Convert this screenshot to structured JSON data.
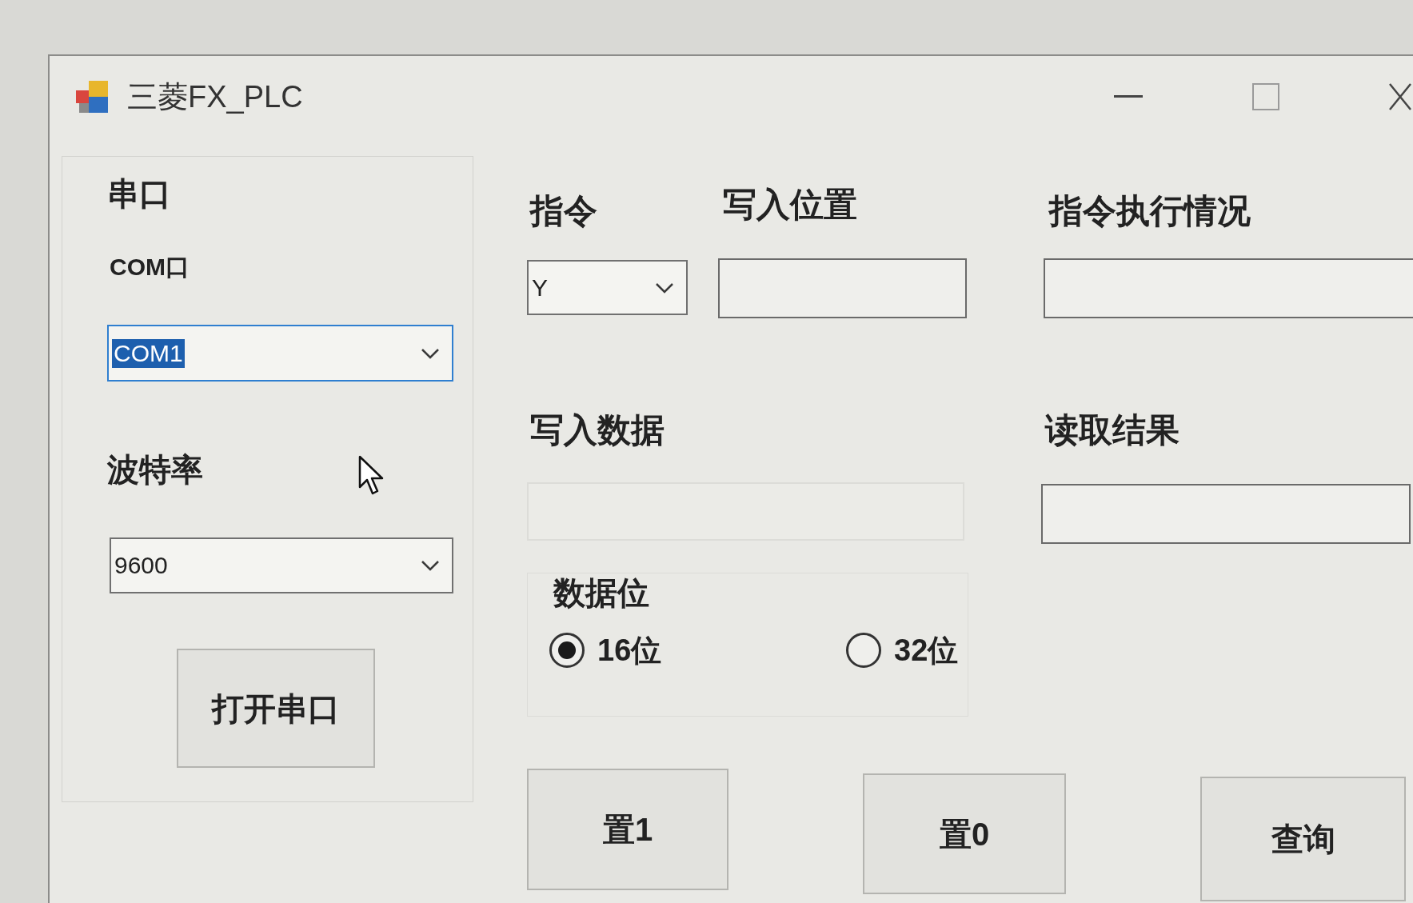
{
  "window": {
    "title": "三菱FX_PLC"
  },
  "serial_group": {
    "title": "串口",
    "port_label": "COM口",
    "port_combo": {
      "value": "COM1",
      "focused": true,
      "text_selected": true
    },
    "baud_label": "波特率",
    "baud_combo": {
      "value": "9600",
      "focused": false
    },
    "open_button": "打开串口"
  },
  "command": {
    "label": "指令",
    "combo": {
      "value": "Y",
      "focused": false
    }
  },
  "write_position": {
    "label": "写入位置",
    "field": {
      "disabled": false
    }
  },
  "status": {
    "label": "指令执行情况",
    "field": {
      "disabled": false
    }
  },
  "write_data": {
    "label": "写入数据",
    "field": {
      "disabled": true
    }
  },
  "read_result": {
    "label": "读取结果",
    "field": {
      "disabled": false
    }
  },
  "data_bits": {
    "title": "数据位",
    "options": [
      {
        "label": "16位",
        "selected": true
      },
      {
        "label": "32位",
        "selected": false
      }
    ]
  },
  "buttons": [
    "置1",
    "置0",
    "查询"
  ]
}
